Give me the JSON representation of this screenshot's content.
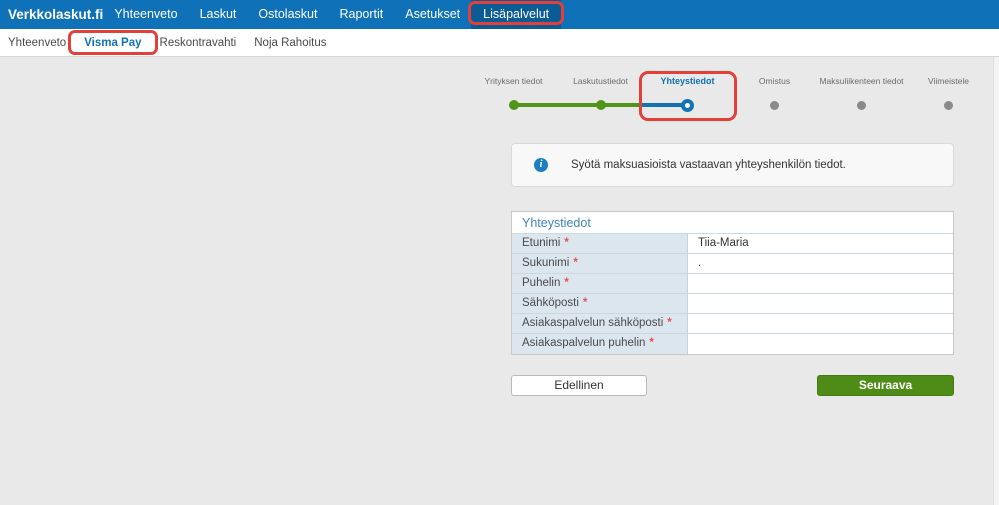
{
  "topnav": {
    "brand": "Verkkolaskut.fi",
    "items": [
      {
        "label": "Yhteenveto",
        "active": false
      },
      {
        "label": "Laskut",
        "active": false
      },
      {
        "label": "Ostolaskut",
        "active": false
      },
      {
        "label": "Raportit",
        "active": false
      },
      {
        "label": "Asetukset",
        "active": false
      },
      {
        "label": "Lisäpalvelut",
        "active": true,
        "annotated": true
      }
    ]
  },
  "subnav": {
    "items": [
      {
        "label": "Yhteenveto",
        "active": false
      },
      {
        "label": "Visma Pay",
        "active": true,
        "annotated": true
      },
      {
        "label": "Reskontravahti",
        "active": false
      },
      {
        "label": "Noja Rahoitus",
        "active": false
      }
    ]
  },
  "stepper": {
    "steps": [
      {
        "label": "Yrityksen tiedot",
        "state": "done"
      },
      {
        "label": "Laskutustiedot",
        "state": "done"
      },
      {
        "label": "Yhteystiedot",
        "state": "current",
        "annotated": true
      },
      {
        "label": "Omistus",
        "state": "upcoming"
      },
      {
        "label": "Maksuliikenteen tiedot",
        "state": "upcoming"
      },
      {
        "label": "Viimeistele",
        "state": "upcoming"
      }
    ]
  },
  "info": {
    "icon": "info-icon",
    "icon_glyph": "i",
    "text": "Syötä maksuasioista vastaavan yhteyshenkilön tiedot."
  },
  "form": {
    "title": "Yhteystiedot",
    "required_marker": "*",
    "rows": [
      {
        "label": "Etunimi",
        "required": true,
        "value": "Tiia-Maria"
      },
      {
        "label": "Sukunimi",
        "required": true,
        "value": "."
      },
      {
        "label": "Puhelin",
        "required": true,
        "value": ""
      },
      {
        "label": "Sähköposti",
        "required": true,
        "value": ""
      },
      {
        "label": "Asiakaspalvelun sähköposti",
        "required": true,
        "value": ""
      },
      {
        "label": "Asiakaspalvelun puhelin",
        "required": true,
        "value": ""
      }
    ]
  },
  "buttons": {
    "previous": "Edellinen",
    "next": "Seuraava"
  },
  "colors": {
    "topnav_bg": "#0f72b8",
    "topnav_active_bg": "#0b5b94",
    "annotation_red": "#e2403a",
    "step_done_green": "#4e9519",
    "step_current_blue": "#1273b4",
    "step_upcoming_gray": "#8a8a8a",
    "link_blue": "#1172b2",
    "next_button_green": "#4f8c17",
    "label_cell_bg": "#dce6ef",
    "page_bg": "#e9e9e9"
  }
}
